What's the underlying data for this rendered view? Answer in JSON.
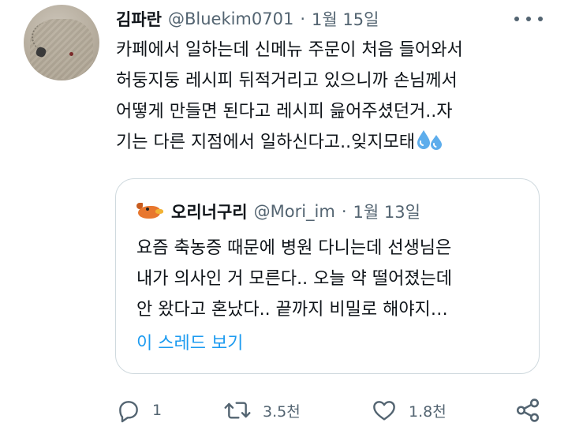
{
  "author": {
    "name": "김파란",
    "handle": "@Bluekim0701",
    "date": "1월 15일"
  },
  "tweet_lines": [
    "카페에서 일하는데 신메뉴 주문이 처음 들어와서",
    "허둥지둥 레시피 뒤적거리고 있으니까 손님께서",
    "어떻게 만들면 된다고 레시피 읊어주셨던거..자",
    "기는 다른 지점에서 일하신다고..잊지모태"
  ],
  "quoted": {
    "name": "오리너구리",
    "handle": "@Mori_im",
    "date": "1월 13일",
    "lines": [
      "요즘 축농증 때문에 병원 다니는데 선생님은",
      "내가 의사인 거 모른다.. 오늘 약 떨어졌는데",
      "안 왔다고 혼났다.. 끝까지 비밀로 해야지…"
    ],
    "thread_link": "이 스레드 보기"
  },
  "actions": {
    "replies": "1",
    "retweets": "3.5천",
    "likes": "1.8천"
  },
  "icons": {
    "reply": "reply-icon",
    "retweet": "retweet-icon",
    "like": "heart-icon",
    "share": "share-icon",
    "more": "more-icon",
    "emoji": "sweat-droplets-emoji"
  },
  "colors": {
    "link": "#1d9bf0",
    "secondary_text": "#536471",
    "border": "#cfd9de"
  }
}
